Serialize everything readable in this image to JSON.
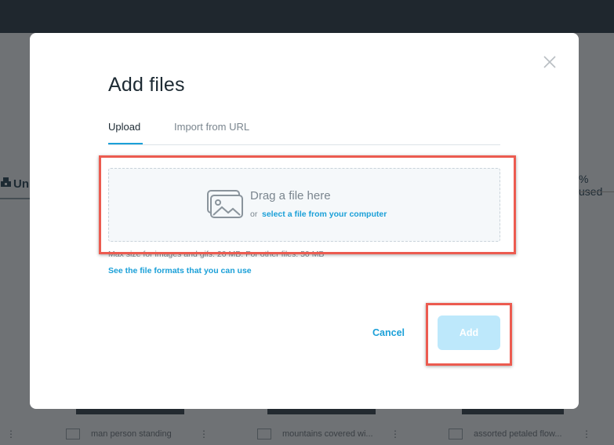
{
  "background": {
    "left_tab_label": "Un",
    "used_label": "% used",
    "files": [
      {
        "name": "man person standing"
      },
      {
        "name": "mountains covered wi..."
      },
      {
        "name": "assorted petaled flow..."
      }
    ]
  },
  "modal": {
    "title": "Add files",
    "tabs": [
      {
        "label": "Upload",
        "active": true
      },
      {
        "label": "Import from URL",
        "active": false
      }
    ],
    "dropzone": {
      "main_text": "Drag a file here",
      "or_text": "or",
      "link_text": "select a file from your computer"
    },
    "max_size_text": "Max size for images and gifs: 20 MB. For other files: 50 MB",
    "formats_link": "See the file formats that you can use",
    "cancel_label": "Cancel",
    "add_label": "Add",
    "add_enabled": false
  },
  "colors": {
    "accent": "#1ba0d8",
    "highlight": "#ec5b50",
    "add_disabled": "#bde8fb"
  }
}
